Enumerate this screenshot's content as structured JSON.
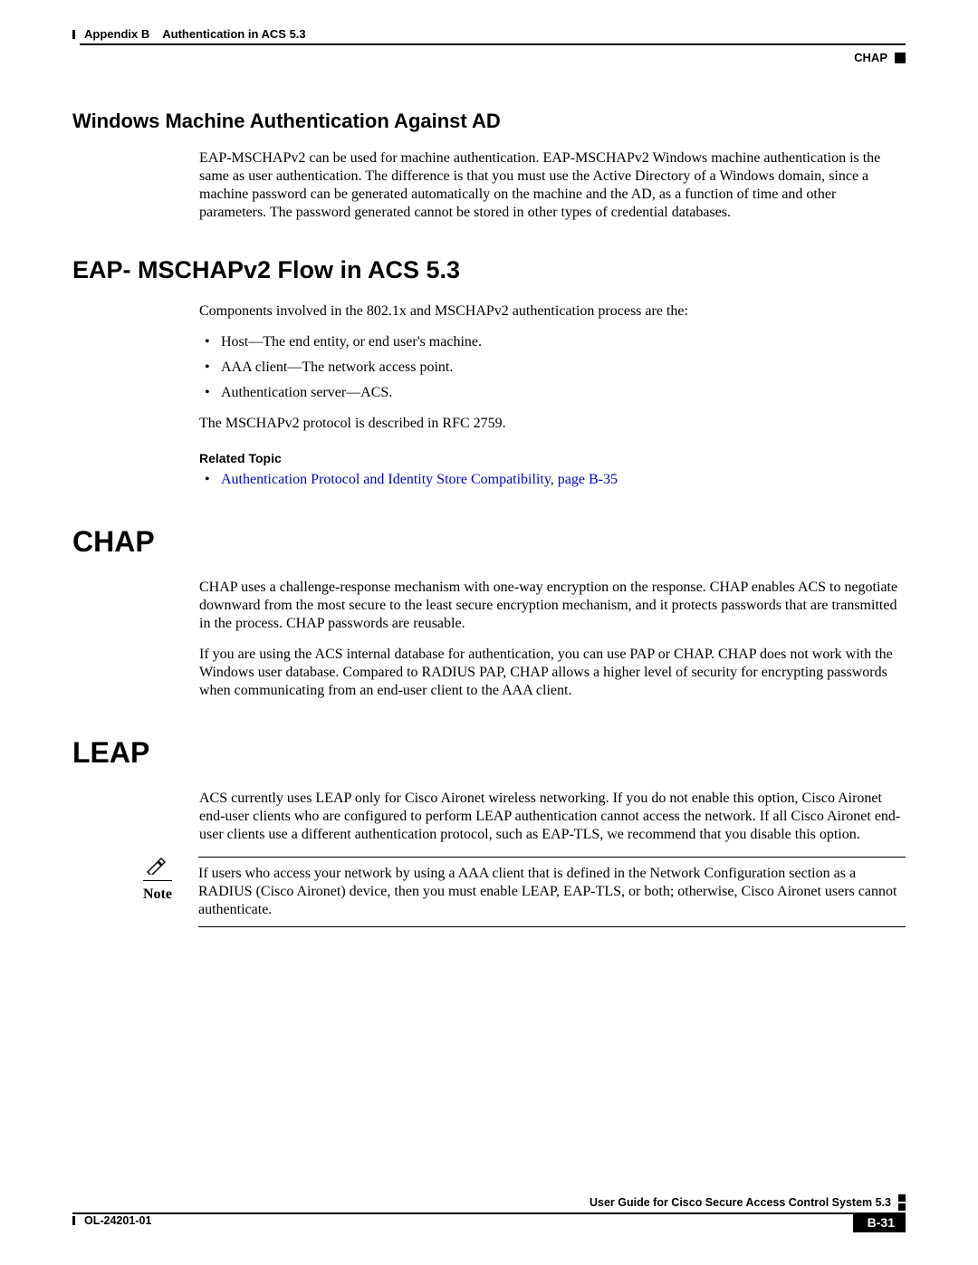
{
  "header": {
    "appendix": "Appendix B",
    "title": "Authentication in ACS 5.3",
    "right_label": "CHAP"
  },
  "section1": {
    "heading": "Windows Machine Authentication Against AD",
    "para": "EAP-MSCHAPv2 can be used for machine authentication. EAP-MSCHAPv2 Windows machine authentication is the same as user authentication. The difference is that you must use the Active Directory of a Windows domain, since a machine password can be generated automatically on the machine and the AD, as a function of time and other parameters. The password generated cannot be stored in other types of credential databases."
  },
  "section2": {
    "heading": "EAP- MSCHAPv2 Flow in ACS 5.3",
    "intro": "Components involved in the 802.1x and MSCHAPv2 authentication process are the:",
    "bullets": [
      "Host—The end entity, or end user's machine.",
      "AAA client—The network access point.",
      "Authentication server—ACS."
    ],
    "after_bullets": "The MSCHAPv2 protocol is described in RFC 2759.",
    "related_label": "Related Topic",
    "related_link": "Authentication Protocol and Identity Store Compatibility, page B-35"
  },
  "chap": {
    "heading": "CHAP",
    "p1": "CHAP uses a challenge-response mechanism with one-way encryption on the response. CHAP enables ACS to negotiate downward from the most secure to the least secure encryption mechanism, and it protects passwords that are transmitted in the process. CHAP passwords are reusable.",
    "p2": "If you are using the ACS internal database for authentication, you can use PAP or CHAP. CHAP does not work with the Windows user database. Compared to RADIUS PAP, CHAP allows a higher level of security for encrypting passwords when communicating from an end-user client to the AAA client."
  },
  "leap": {
    "heading": "LEAP",
    "p1": "ACS currently uses LEAP only for Cisco Aironet wireless networking. If you do not enable this option, Cisco Aironet end-user clients who are configured to perform LEAP authentication cannot access the network. If all Cisco Aironet end-user clients use a different authentication protocol, such as EAP-TLS, we recommend that you disable this option.",
    "note_label": "Note",
    "note_text": "If users who access your network by using a AAA client that is defined in the Network Configuration section as a RADIUS (Cisco Aironet) device, then you must enable LEAP, EAP-TLS, or both; otherwise, Cisco Aironet users cannot authenticate."
  },
  "footer": {
    "doc_title": "User Guide for Cisco Secure Access Control System 5.3",
    "ol": "OL-24201-01",
    "page_num": "B-31"
  }
}
